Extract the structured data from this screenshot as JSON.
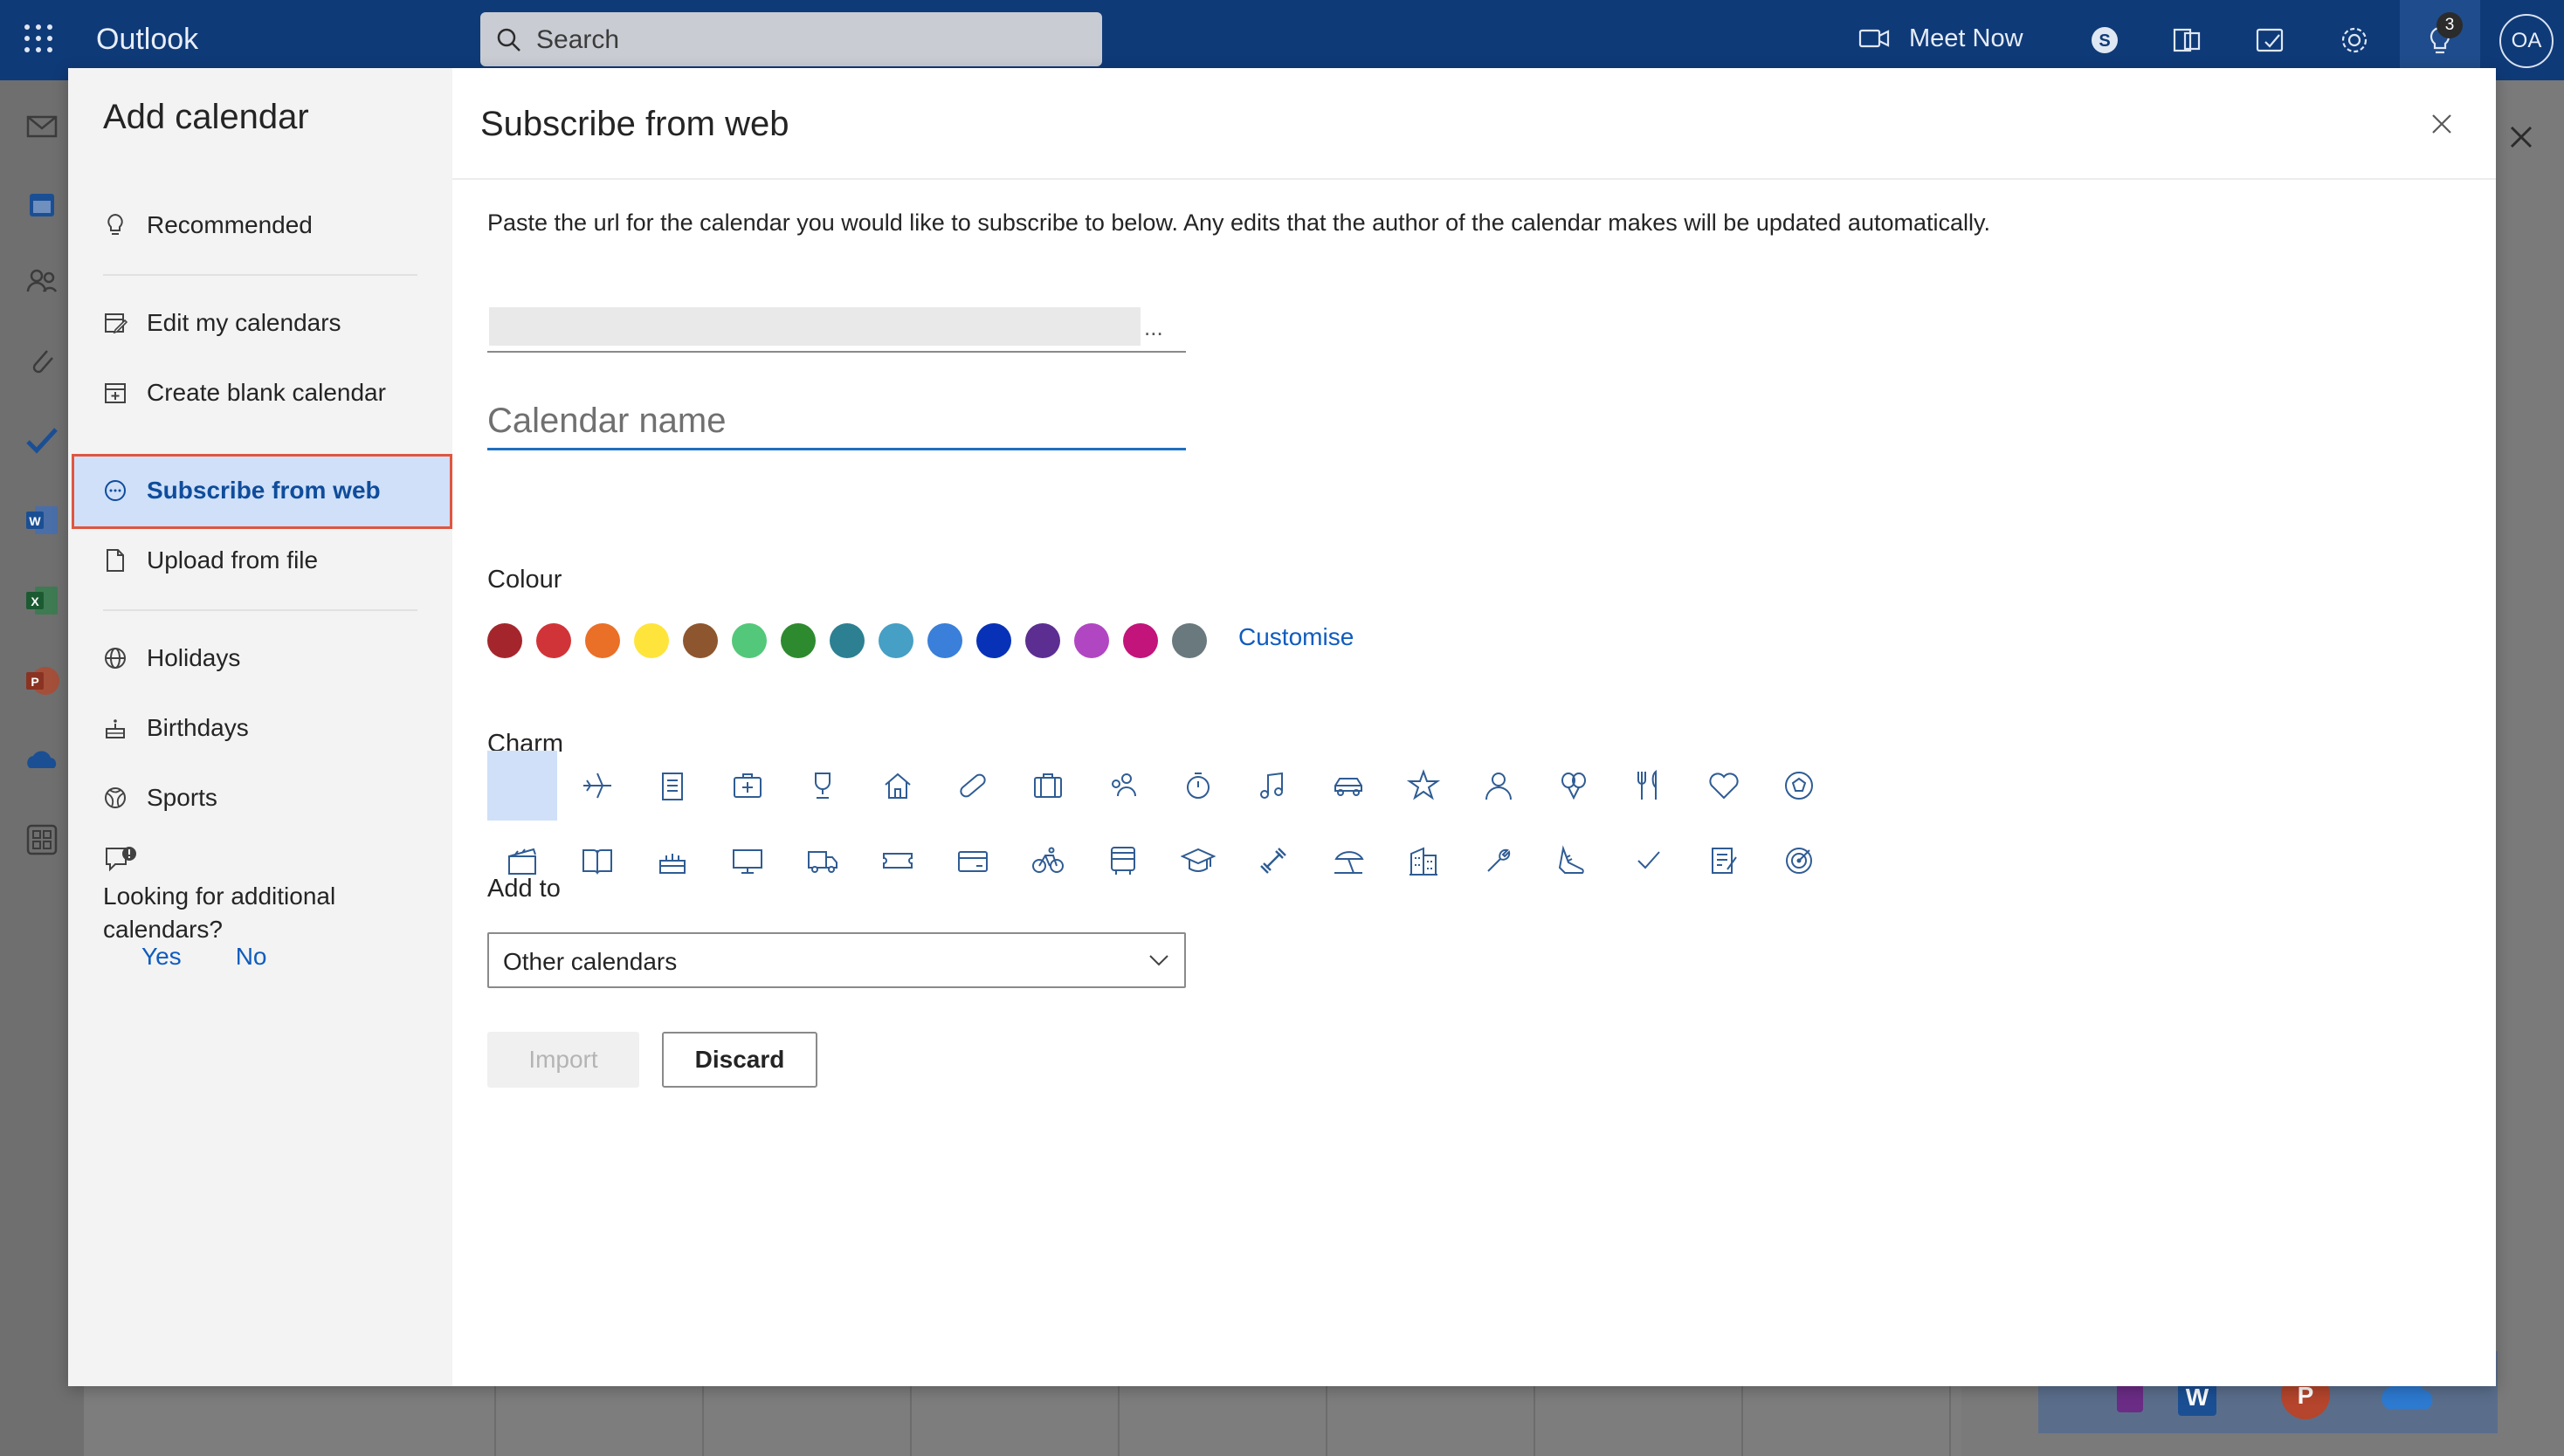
{
  "topbar": {
    "app_title": "Outlook",
    "search_placeholder": "Search",
    "meet_now_label": "Meet Now",
    "notification_count": "3",
    "avatar_initials": "OA"
  },
  "rail": {
    "items": [
      "mail-icon",
      "calendar-icon",
      "people-icon",
      "attach-icon",
      "todo-icon",
      "word-icon",
      "excel-icon",
      "powerpoint-icon",
      "onedrive-icon",
      "more-apps-icon"
    ]
  },
  "dialog": {
    "title": "Add calendar",
    "nav": {
      "recommended": "Recommended",
      "edit_my_calendars": "Edit my calendars",
      "create_blank_calendar": "Create blank calendar",
      "subscribe_from_web": "Subscribe from web",
      "upload_from_file": "Upload from file",
      "holidays": "Holidays",
      "birthdays": "Birthdays",
      "sports": "Sports"
    },
    "feedback": {
      "question": "Looking for additional calendars?",
      "yes": "Yes",
      "no": "No"
    }
  },
  "form": {
    "heading": "Subscribe from web",
    "description": "Paste the url for the calendar you would like to subscribe to below. Any edits that the author of the calendar makes will be updated automatically.",
    "url_overflow": "...",
    "calendar_name_placeholder": "Calendar name",
    "colour_label": "Colour",
    "colours": [
      "#a4262c",
      "#d13438",
      "#ea6f27",
      "#ffe43c",
      "#8e562e",
      "#53c87a",
      "#2e8a2e",
      "#2c8092",
      "#469fc4",
      "#3a7fd9",
      "#0732b8",
      "#5c2e91",
      "#b146c2",
      "#c2147a",
      "#69797e"
    ],
    "customise_label": "Customise",
    "charm_label": "Charm",
    "charms_row1": [
      "none",
      "airplane-icon",
      "clipboard-icon",
      "medical-kit-icon",
      "trophy-icon",
      "home-icon",
      "bandage-icon",
      "briefcase-icon",
      "people-icon",
      "stopwatch-icon",
      "music-note-icon",
      "car-icon",
      "star-icon",
      "person-icon",
      "balloons-icon",
      "fork-knife-icon",
      "heart-icon",
      "soccer-ball-icon"
    ],
    "charms_row2": [
      "clapperboard-icon",
      "book-icon",
      "cake-icon",
      "monitor-icon",
      "truck-icon",
      "ticket-icon",
      "payment-card-icon",
      "bicycle-icon",
      "bus-icon",
      "graduation-cap-icon",
      "dumbbell-icon",
      "beach-icon",
      "building-icon",
      "wrench-icon",
      "shoe-icon",
      "checkmark-icon",
      "notes-icon",
      "target-icon"
    ],
    "add_to_label": "Add to",
    "add_to_value": "Other calendars",
    "import_label": "Import",
    "discard_label": "Discard"
  }
}
